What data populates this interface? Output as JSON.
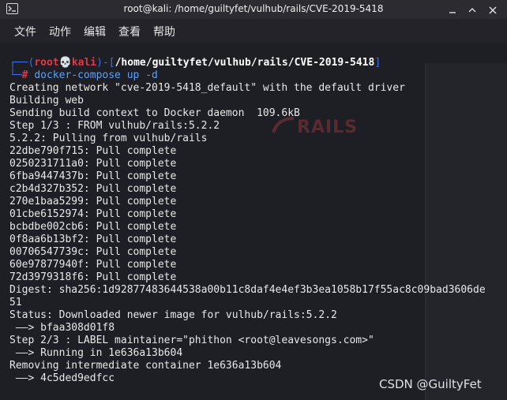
{
  "window": {
    "title": "root@kali: /home/guiltyfet/vulhub/rails/CVE-2019-5418"
  },
  "menu": [
    "文件",
    "动作",
    "编辑",
    "查看",
    "帮助"
  ],
  "prompt": {
    "frame_top": "┌──(",
    "user": "root",
    "skull": "💀",
    "host": "kali",
    "frame_mid": ")-[",
    "path": "/home/guiltyfet/vulhub/rails/CVE-2019-5418",
    "frame_end": "]",
    "frame_bottom": "└─",
    "hash": "# ",
    "command": "docker-compose",
    "args": " up -d"
  },
  "output": [
    "Creating network \"cve-2019-5418_default\" with the default driver",
    "Building web",
    "Sending build context to Docker daemon  109.6kB",
    "Step 1/3 : FROM vulhub/rails:5.2.2",
    "5.2.2: Pulling from vulhub/rails",
    "22dbe790f715: Pull complete",
    "0250231711a0: Pull complete",
    "6fba9447437b: Pull complete",
    "c2b4d327b352: Pull complete",
    "270e1baa5299: Pull complete",
    "01cbe6152974: Pull complete",
    "bcbdbe002cb6: Pull complete",
    "0f8aa6b13bf2: Pull complete",
    "00706547739c: Pull complete",
    "60e97877940f: Pull complete",
    "72d3979318f6: Pull complete",
    "Digest: sha256:1d92877483644538a00b11c8daf4e4ef3b3ea1058b17f55ac8c09bad3606de",
    "51",
    "Status: Downloaded newer image for vulhub/rails:5.2.2",
    " ——> bfaa308d01f8",
    "Step 2/3 : LABEL maintainer=\"phithon <root@leavesongs.com>\"",
    " ——> Running in 1e636a13b604",
    "Removing intermediate container 1e636a13b604",
    " ——> 4c5ded9edfcc"
  ],
  "watermark": "CSDN @GuiltyFet",
  "colors": {
    "prompt_frame": "#3c6ef0",
    "prompt_user": "#e0384a",
    "command": "#5aa0ff",
    "background": "#1e1f24"
  }
}
